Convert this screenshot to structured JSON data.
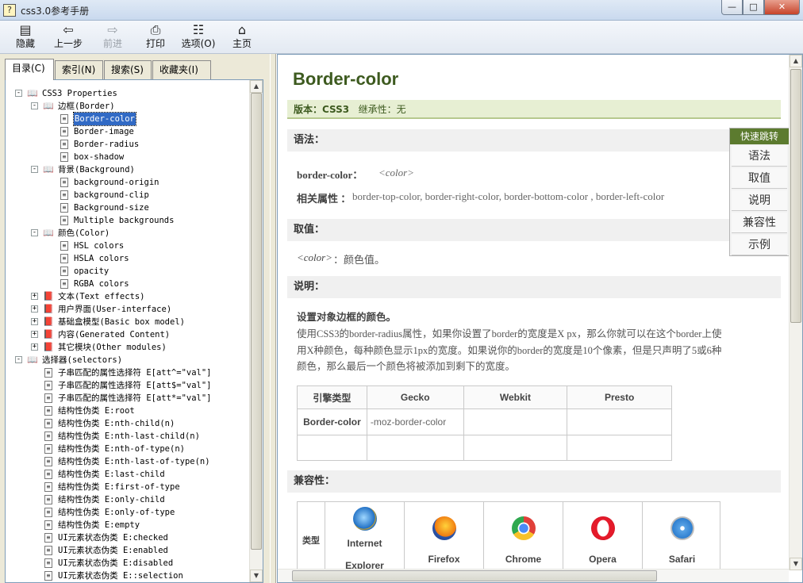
{
  "window": {
    "title": "css3.0参考手册"
  },
  "toolbar": [
    {
      "label": "隐藏",
      "icon": "hide-icon"
    },
    {
      "label": "上一步",
      "icon": "back-arrow-icon"
    },
    {
      "label": "前进",
      "icon": "forward-arrow-icon",
      "disabled": true
    },
    {
      "label": "打印",
      "icon": "printer-icon"
    },
    {
      "label": "选项(O)",
      "icon": "options-icon"
    },
    {
      "label": "主页",
      "icon": "home-icon"
    }
  ],
  "tabs": [
    "目录(C)",
    "索引(N)",
    "搜索(S)",
    "收藏夹(I)"
  ],
  "tree": [
    {
      "text": "CSS3 Properties",
      "type": "book-open",
      "exp": "-",
      "level": 0
    },
    {
      "text": "边框(Border)",
      "type": "book-open",
      "exp": "-",
      "level": 1
    },
    {
      "text": "Border-color",
      "type": "page",
      "level": 2,
      "selected": true
    },
    {
      "text": "Border-image",
      "type": "page",
      "level": 2
    },
    {
      "text": "Border-radius",
      "type": "page",
      "level": 2
    },
    {
      "text": "box-shadow",
      "type": "page",
      "level": 2
    },
    {
      "text": "背景(Background)",
      "type": "book-open",
      "exp": "-",
      "level": 1
    },
    {
      "text": "background-origin",
      "type": "page",
      "level": 2
    },
    {
      "text": "background-clip",
      "type": "page",
      "level": 2
    },
    {
      "text": "Background-size",
      "type": "page",
      "level": 2
    },
    {
      "text": "Multiple backgrounds",
      "type": "page",
      "level": 2
    },
    {
      "text": "颜色(Color)",
      "type": "book-open",
      "exp": "-",
      "level": 1
    },
    {
      "text": "HSL colors",
      "type": "page",
      "level": 2
    },
    {
      "text": "HSLA colors",
      "type": "page",
      "level": 2
    },
    {
      "text": "opacity",
      "type": "page",
      "level": 2
    },
    {
      "text": "RGBA colors",
      "type": "page",
      "level": 2
    },
    {
      "text": "文本(Text effects)",
      "type": "book-closed",
      "exp": "+",
      "level": 1
    },
    {
      "text": "用户界面(User-interface)",
      "type": "book-closed",
      "exp": "+",
      "level": 1
    },
    {
      "text": "基础盒模型(Basic box model)",
      "type": "book-closed",
      "exp": "+",
      "level": 1
    },
    {
      "text": "内容(Generated Content)",
      "type": "book-closed",
      "exp": "+",
      "level": 1
    },
    {
      "text": "其它模块(Other modules)",
      "type": "book-closed",
      "exp": "+",
      "level": 1
    },
    {
      "text": "选择器(selectors)",
      "type": "book-open",
      "exp": "-",
      "level": 0
    },
    {
      "text": "子串匹配的属性选择符 E[att^=\"val\"]",
      "type": "page",
      "level": 1
    },
    {
      "text": "子串匹配的属性选择符 E[att$=\"val\"]",
      "type": "page",
      "level": 1
    },
    {
      "text": "子串匹配的属性选择符 E[att*=\"val\"]",
      "type": "page",
      "level": 1
    },
    {
      "text": "结构性伪类 E:root",
      "type": "page",
      "level": 1
    },
    {
      "text": "结构性伪类 E:nth-child(n)",
      "type": "page",
      "level": 1
    },
    {
      "text": "结构性伪类 E:nth-last-child(n)",
      "type": "page",
      "level": 1
    },
    {
      "text": "结构性伪类 E:nth-of-type(n)",
      "type": "page",
      "level": 1
    },
    {
      "text": "结构性伪类 E:nth-last-of-type(n)",
      "type": "page",
      "level": 1
    },
    {
      "text": "结构性伪类 E:last-child",
      "type": "page",
      "level": 1
    },
    {
      "text": "结构性伪类 E:first-of-type",
      "type": "page",
      "level": 1
    },
    {
      "text": "结构性伪类 E:only-child",
      "type": "page",
      "level": 1
    },
    {
      "text": "结构性伪类 E:only-of-type",
      "type": "page",
      "level": 1
    },
    {
      "text": "结构性伪类 E:empty",
      "type": "page",
      "level": 1
    },
    {
      "text": "UI元素状态伪类 E:checked",
      "type": "page",
      "level": 1
    },
    {
      "text": "UI元素状态伪类 E:enabled",
      "type": "page",
      "level": 1
    },
    {
      "text": "UI元素状态伪类 E:disabled",
      "type": "page",
      "level": 1
    },
    {
      "text": "UI元素状态伪类 E::selection",
      "type": "page",
      "level": 1
    }
  ],
  "article": {
    "title": "Border-color",
    "version_label": "版本：",
    "version_value": "CSS3",
    "inherit": "继承性：无",
    "syntax_head": "语法：",
    "syntax_prop": "border-color：",
    "syntax_value": "<color>",
    "related_label": "相关属性 ：",
    "related_value": "border-top-color, border-right-color, border-bottom-color , border-left-color",
    "values_head": "取值：",
    "value_name": "<color>",
    "value_desc": "：颜色值。",
    "desc_head": "说明：",
    "desc_bold": "设置对象边框的颜色。",
    "desc_p": "使用CSS3的border-radius属性，如果你设置了border的宽度是X px，那么你就可以在这个border上使用X种颜色，每种颜色显示1px的宽度。如果说你的border的宽度是10个像素，但是只声明了5或6种颜色，那么最后一个颜色将被添加到剩下的宽度。",
    "table": {
      "headers": [
        "引擎类型",
        "Gecko",
        "Webkit",
        "Presto"
      ],
      "rows": [
        [
          "Border-color",
          "-moz-border-color",
          "",
          ""
        ],
        [
          "",
          "",
          "",
          ""
        ]
      ]
    },
    "compat_head": "兼容性：",
    "compat_type": "类型",
    "browsers": [
      "Internet Explorer",
      "Firefox",
      "Chrome",
      "Opera",
      "Safari"
    ]
  },
  "jump": {
    "title": "快速跳转",
    "items": [
      "语法",
      "取值",
      "说明",
      "兼容性",
      "示例"
    ]
  },
  "colors": {
    "accent": "#5c7b2f",
    "title": "#3d5a1f",
    "version_bg": "#e7efd3",
    "selection": "#316ac5"
  }
}
